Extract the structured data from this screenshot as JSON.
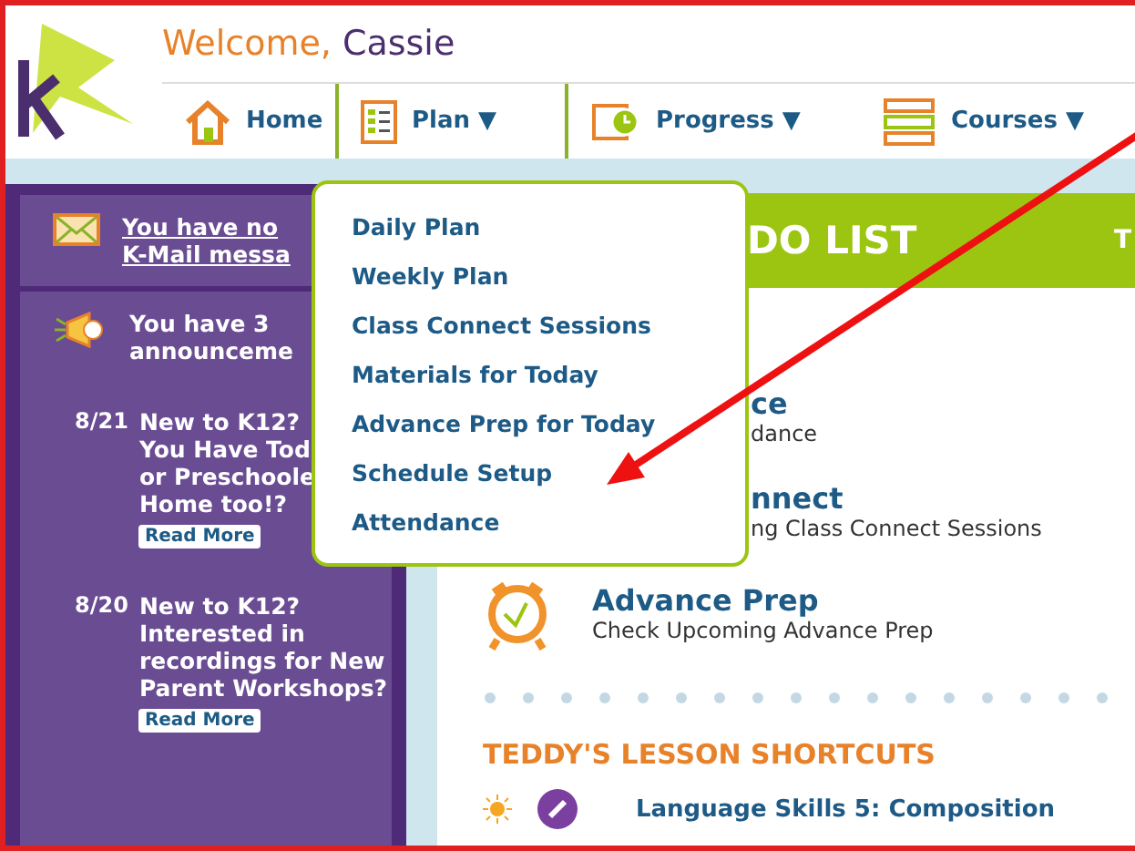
{
  "header": {
    "greeting": "Welcome,",
    "user": "Cassie",
    "nav": [
      {
        "label": "Home",
        "selected": false
      },
      {
        "label": "Plan",
        "caret": "▼",
        "selected": true
      },
      {
        "label": "Progress",
        "caret": "▼",
        "selected": false
      },
      {
        "label": "Courses",
        "caret": "▼",
        "selected": false
      }
    ]
  },
  "plan_menu": {
    "items": [
      "Daily Plan",
      "Weekly Plan",
      "Class Connect Sessions",
      "Materials for Today",
      "Advance Prep for Today",
      "Schedule Setup",
      "Attendance"
    ]
  },
  "sidebar": {
    "kmail": [
      "You have no",
      "K-Mail messa"
    ],
    "announcements": [
      "You have 3",
      "announceme"
    ],
    "news": [
      {
        "date": "8/21",
        "lines": [
          "New to K12?",
          "You Have Tod",
          "or Preschoole",
          "Home too!?"
        ],
        "button": "Read More"
      },
      {
        "date": "8/20",
        "lines": [
          "New to K12?",
          "Interested in",
          "recordings for New",
          "Parent Workshops?"
        ],
        "button": "Read More"
      }
    ]
  },
  "todo": {
    "title": "DO LIST",
    "title_right": "T",
    "items": [
      {
        "kind": "text",
        "title": "ce",
        "subtitle": "dance"
      },
      {
        "kind": "text",
        "title": "nnect",
        "subtitle": "ng Class Connect Sessions"
      },
      {
        "kind": "icon",
        "title": "Advance Prep",
        "subtitle": "Check Upcoming Advance Prep"
      }
    ],
    "shortcuts_title": "TEDDY'S LESSON SHORTCUTS",
    "shortcuts": [
      {
        "label": "Language Skills 5: Composition"
      }
    ]
  }
}
